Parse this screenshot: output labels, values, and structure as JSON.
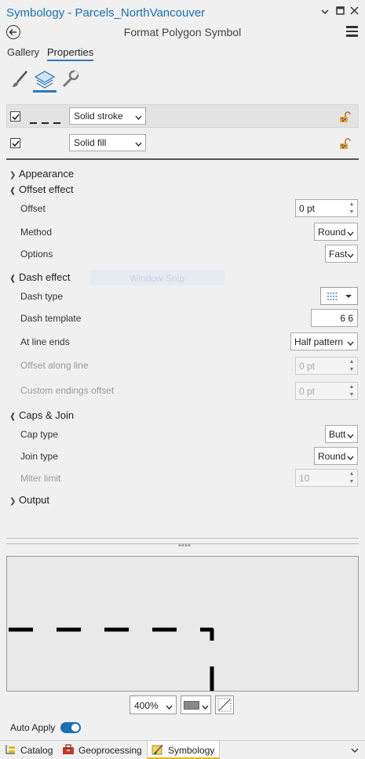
{
  "window": {
    "title": "Symbology - Parcels_NorthVancouver",
    "subtitle": "Format Polygon Symbol"
  },
  "tabs": [
    {
      "label": "Gallery",
      "active": false
    },
    {
      "label": "Properties",
      "active": true
    }
  ],
  "icon_tabs": [
    "paintbrush-icon",
    "layers-icon",
    "wrench-icon"
  ],
  "layers": [
    {
      "type_value": "Solid stroke",
      "checked": true
    },
    {
      "type_value": "Solid fill",
      "checked": true
    }
  ],
  "sections": {
    "appearance": "Appearance",
    "offset_effect": "Offset effect",
    "dash_effect": "Dash effect",
    "caps_join": "Caps & Join",
    "output": "Output"
  },
  "offset": {
    "offset_label": "Offset",
    "offset_value": "0 pt",
    "method_label": "Method",
    "method_value": "Round",
    "options_label": "Options",
    "options_value": "Fast"
  },
  "dash": {
    "dash_type_label": "Dash type",
    "dash_template_label": "Dash template",
    "dash_template_value": "6 6",
    "line_ends_label": "At line ends",
    "line_ends_value": "Half pattern",
    "offset_along_label": "Offset along line",
    "offset_along_value": "0 pt",
    "custom_endings_label": "Custom endings offset",
    "custom_endings_value": "0 pt"
  },
  "caps": {
    "cap_type_label": "Cap type",
    "cap_type_value": "Butt",
    "join_type_label": "Join type",
    "join_type_value": "Round",
    "miter_label": "Miter limit",
    "miter_value": "10"
  },
  "overlay": {
    "snip_text": "Window Snip"
  },
  "preview_controls": {
    "zoom": "400%"
  },
  "auto_apply": {
    "label": "Auto Apply",
    "on": true
  },
  "bottom_tabs": [
    {
      "label": "Catalog"
    },
    {
      "label": "Geoprocessing"
    },
    {
      "label": "Symbology",
      "active": true
    }
  ],
  "colors": {
    "accent": "#1a6fb5",
    "tab_underline": "#2e7ab8",
    "symbology_tab": "#e0b91a"
  }
}
